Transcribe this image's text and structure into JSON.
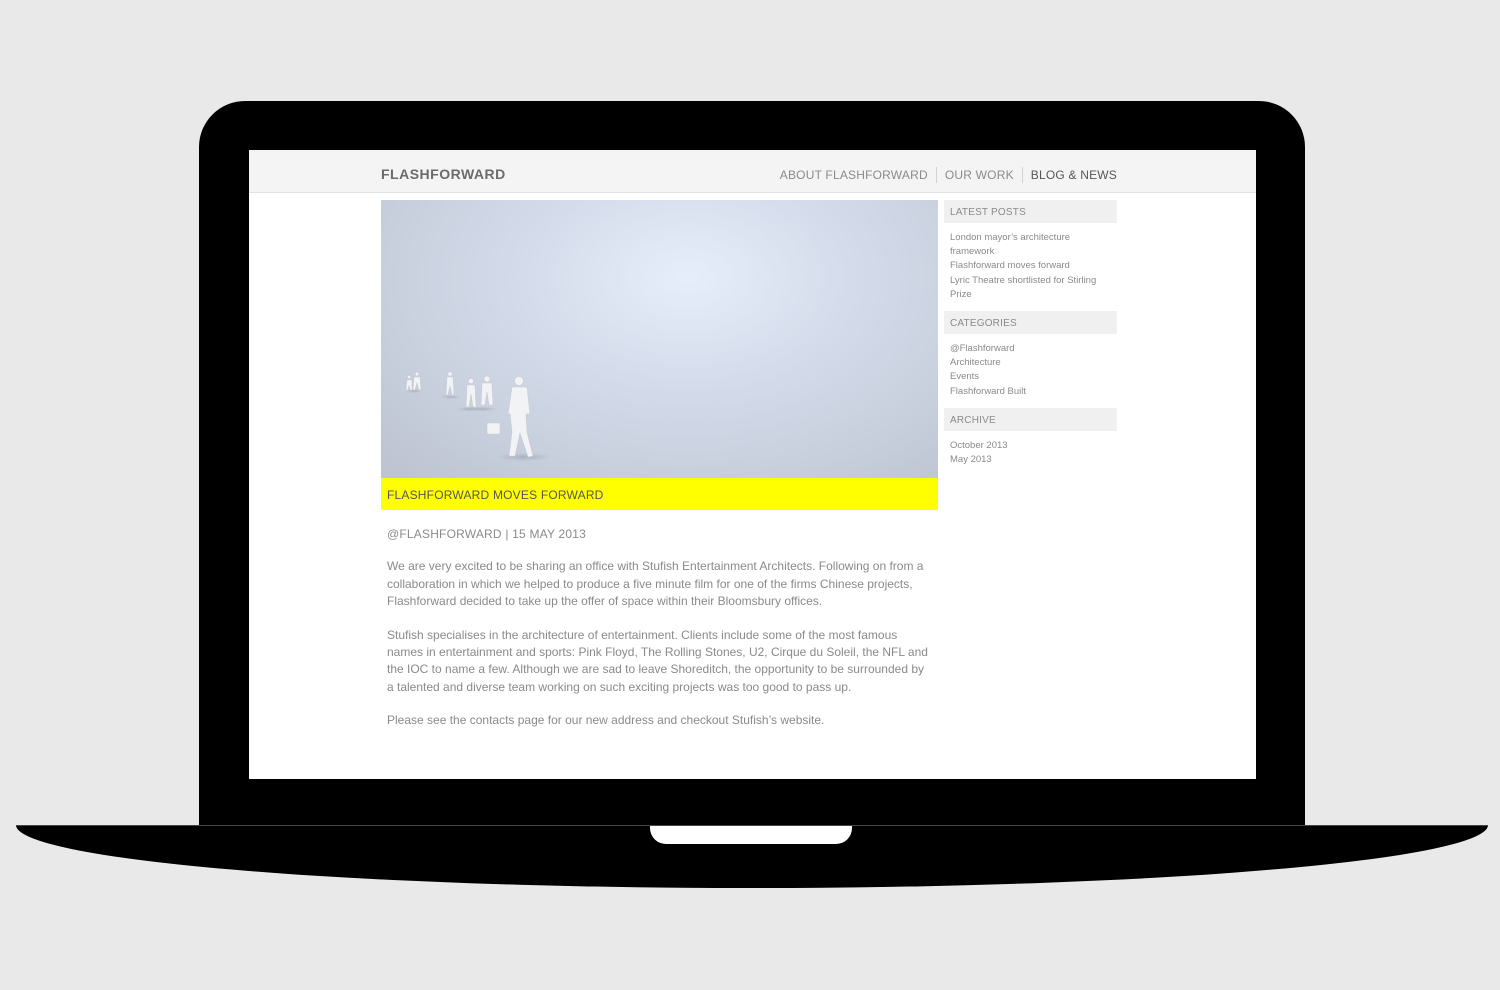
{
  "site": {
    "logo": "FLASHFORWARD",
    "nav": [
      "ABOUT FLASHFORWARD",
      "OUR WORK",
      "BLOG & NEWS"
    ]
  },
  "post": {
    "title": "FLASHFORWARD MOVES FORWARD",
    "meta": "@FLASHFORWARD | 15 MAY 2013",
    "paragraphs": [
      "We are very excited to be sharing an office with Stufish Entertainment Architects. Following on from a collaboration in which we helped to produce a five minute film for one of the firms Chinese projects, Flashforward decided to take up the offer of space within their Bloomsbury offices.",
      "Stufish specialises in the architecture of entertainment. Clients include some of the most famous names in entertainment and sports: Pink Floyd, The Rolling Stones, U2, Cirque du Soleil, the NFL and the IOC to name a few. Although we are sad to leave Shoreditch, the opportunity to be surrounded by a talented and diverse team working on such exciting projects was too good to pass up.",
      "Please see the contacts page for our new address and checkout Stufish’s website."
    ]
  },
  "sidebar": {
    "latest": {
      "heading": "LATEST POSTS",
      "items": [
        "London mayor’s architecture framework",
        "Flashforward moves forward",
        "Lyric Theatre shortlisted for Stirling Prize"
      ]
    },
    "categories": {
      "heading": "CATEGORIES",
      "items": [
        "@Flashforward",
        "Architecture",
        "Events",
        "Flashforward Built"
      ]
    },
    "archive": {
      "heading": "ARCHIVE",
      "items": [
        "October 2013",
        "May 2013"
      ]
    }
  },
  "colors": {
    "accent": "#ffff00",
    "text": "#8a8a8a",
    "background": "#e9e9e9"
  }
}
